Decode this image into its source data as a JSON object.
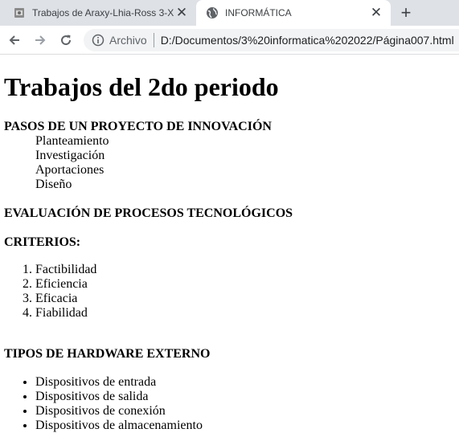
{
  "tabs": [
    {
      "title": "Trabajos de Araxy-Lhia-Ross 3-X",
      "favicon": "page-icon"
    },
    {
      "title": "INFORMÁTICA",
      "favicon": "globe-icon"
    }
  ],
  "newtab_label": "+",
  "close_label": "✕",
  "address_bar": {
    "scheme": "Archivo",
    "url": "D:/Documentos/3%20informatica%202022/Página007.html"
  },
  "page": {
    "heading": "Trabajos del 2do periodo",
    "section1": {
      "title": "PASOS DE UN PROYECTO DE INNOVACIÓN",
      "items": [
        "Planteamiento",
        "Investigación",
        "Aportaciones",
        "Diseño"
      ]
    },
    "section2": {
      "title": "EVALUACIÓN DE PROCESOS TECNOLÓGICOS"
    },
    "section3": {
      "title": "CRITERIOS:",
      "items": [
        "Factibilidad",
        "Eficiencia",
        "Eficacia",
        "Fiabilidad"
      ]
    },
    "section4": {
      "title": "TIPOS DE HARDWARE EXTERNO",
      "items": [
        "Dispositivos de entrada",
        "Dispositivos de salida",
        "Dispositivos de conexión",
        "Dispositivos de almacenamiento"
      ]
    }
  }
}
